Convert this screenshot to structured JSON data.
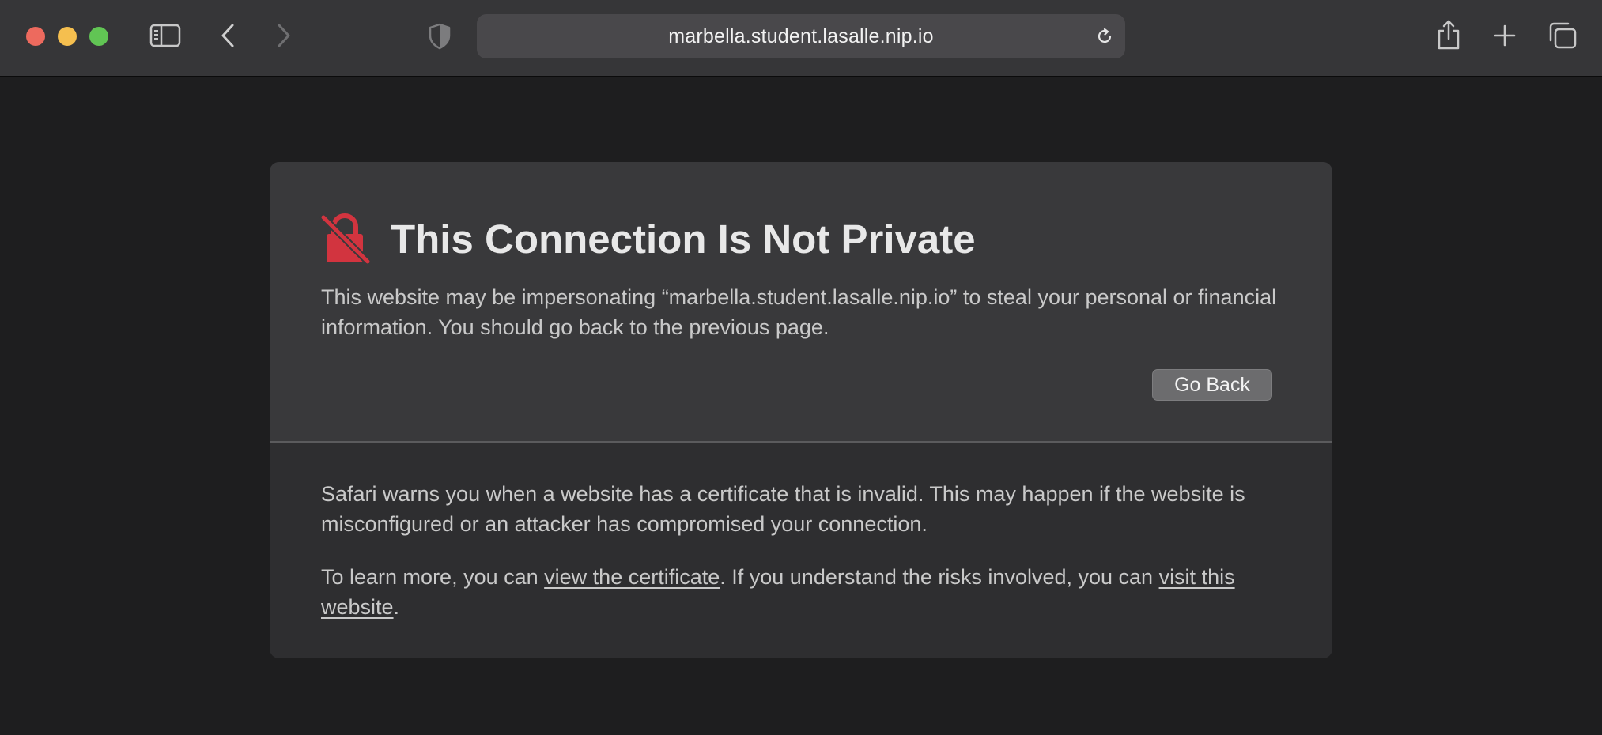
{
  "browser": {
    "address": "marbella.student.lasalle.nip.io",
    "icons": {
      "sidebar": "sidebar-icon",
      "back": "chevron-left-icon",
      "forward": "chevron-right-icon",
      "privacy": "shield-icon",
      "reload": "reload-icon",
      "share": "share-icon",
      "new_tab": "plus-icon",
      "tab_overview": "tabs-icon"
    },
    "colors": {
      "close": "#ed6a5e",
      "minimize": "#f5bf4f",
      "maximize": "#61c554"
    }
  },
  "warning": {
    "icon": "broken-lock-icon",
    "icon_color": "#d2343f",
    "title": "This Connection Is Not Private",
    "description": "This website may be impersonating “marbella.student.lasalle.nip.io” to steal your personal or financial information. You should go back to the previous page.",
    "go_back_label": "Go Back",
    "detail_text": "Safari warns you when a website has a certificate that is invalid. This may happen if the website is misconfigured or an attacker has compromised your connection.",
    "learn_more_prefix": "To learn more, you can ",
    "view_certificate_link": "view the certificate",
    "learn_more_middle": ". If you understand the risks involved, you can ",
    "visit_website_link": "visit this website",
    "learn_more_suffix": "."
  }
}
